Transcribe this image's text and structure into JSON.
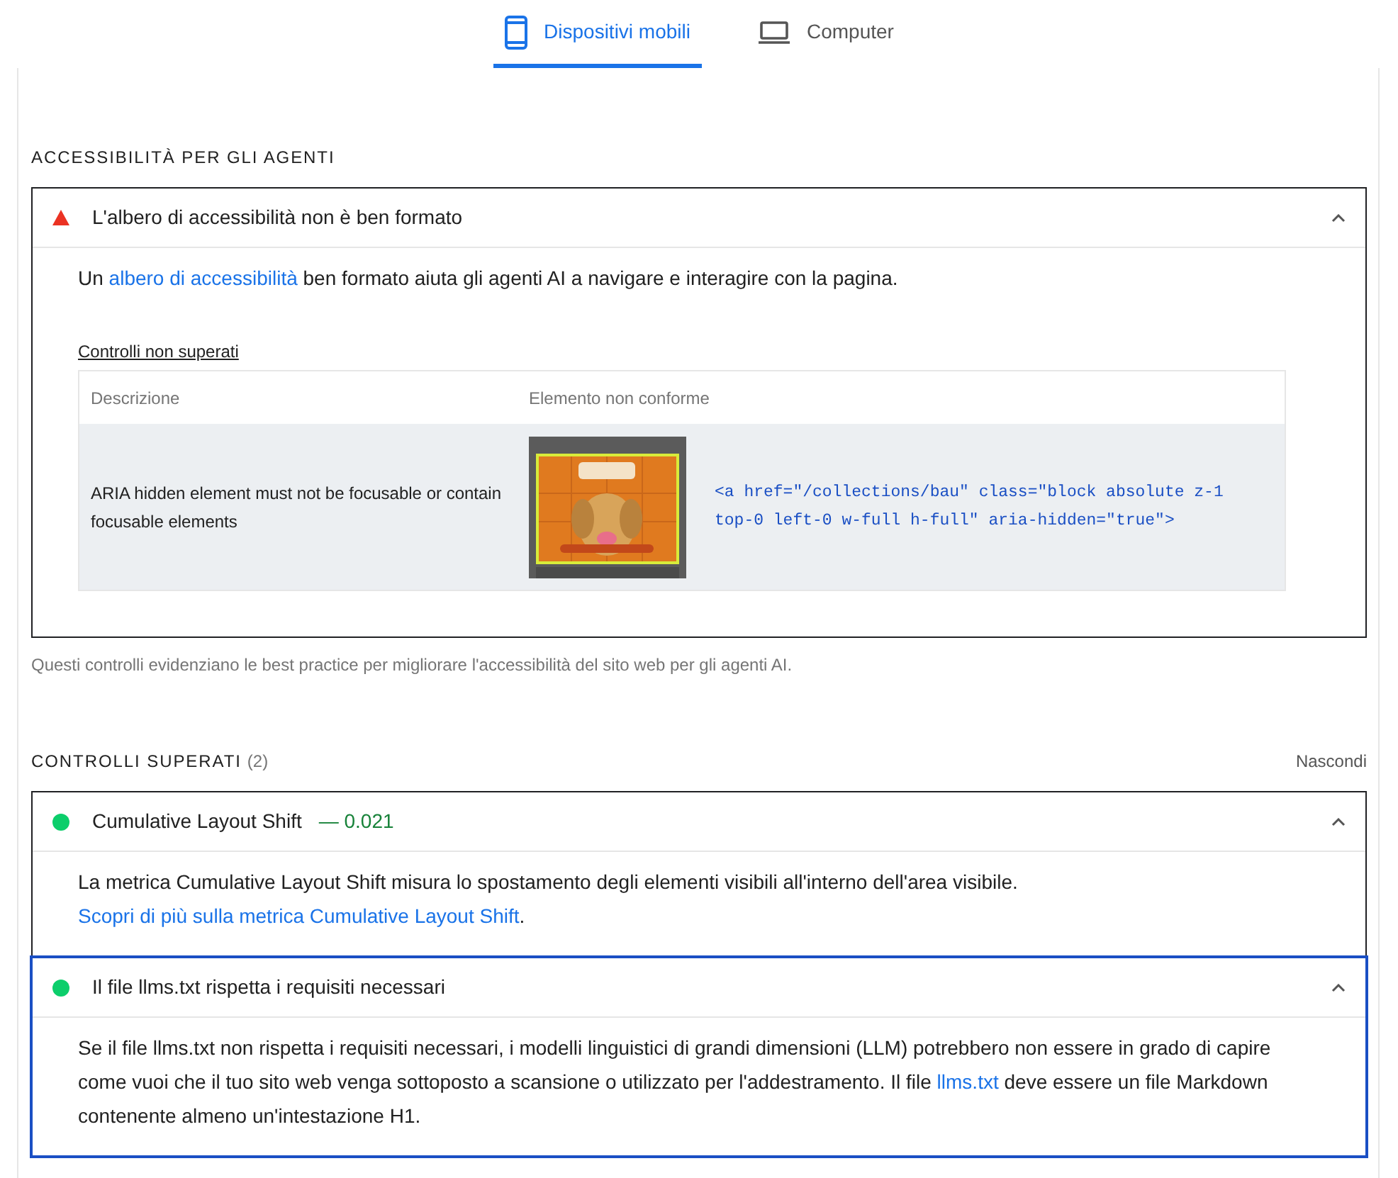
{
  "tabs": [
    {
      "label": "Dispositivi mobili",
      "kind": "mobile",
      "selected": true
    },
    {
      "label": "Computer",
      "kind": "desktop",
      "selected": false
    }
  ],
  "sections": [
    {
      "title": "ACCESSIBILITÀ PER GLI AGENTI",
      "audits": [
        {
          "kind": "fail",
          "title": "L'albero di accessibilità non è ben formato",
          "expanded": true,
          "focused": false,
          "description": [
            {
              "text": "Un "
            },
            {
              "text": "albero di accessibilità",
              "link": true
            },
            {
              "text": " ben formato aiuta gli agenti AI a navigare e interagire con la pagina."
            }
          ],
          "details": {
            "heading": "Controlli non superati",
            "columns": [
              "Descrizione",
              "Elemento non conforme"
            ],
            "rows": [
              {
                "description": "ARIA hidden element must not be focusable or contain focusable elements",
                "snippet": "<a href=\"/collections/bau\" class=\"block absolute z-1 top-0 left-0 w-full h-full\" aria-hidden=\"true\">"
              }
            ]
          }
        }
      ],
      "note": "Questi controlli evidenziano le best practice per migliorare l'accessibilità del sito web per gli agenti AI."
    },
    {
      "title": "CONTROLLI SUPERATI",
      "count": "(2)",
      "toggle": "Nascondi",
      "audits": [
        {
          "kind": "pass",
          "title": "Cumulative Layout Shift",
          "value": "— 0.021",
          "expanded": true,
          "focused": false,
          "description": [
            {
              "text": "La metrica Cumulative Layout Shift misura lo spostamento degli elementi visibili all'interno dell'area visibile. "
            },
            {
              "text": "Scopri di più sulla metrica Cumulative Layout Shift",
              "link": true
            },
            {
              "text": "."
            }
          ]
        },
        {
          "kind": "pass",
          "title": "Il file llms.txt rispetta i requisiti necessari",
          "expanded": true,
          "focused": true,
          "description": [
            {
              "text": "Se il file llms.txt non rispetta i requisiti necessari, i modelli linguistici di grandi dimensioni (LLM) potrebbero non essere in grado di capire come vuoi che il tuo sito web venga sottoposto a scansione o utilizzato per l'addestramento. Il file "
            },
            {
              "text": "llms.txt",
              "link": true
            },
            {
              "text": " deve essere un file Markdown contenente almeno un'intestazione H1."
            }
          ]
        }
      ]
    }
  ]
}
